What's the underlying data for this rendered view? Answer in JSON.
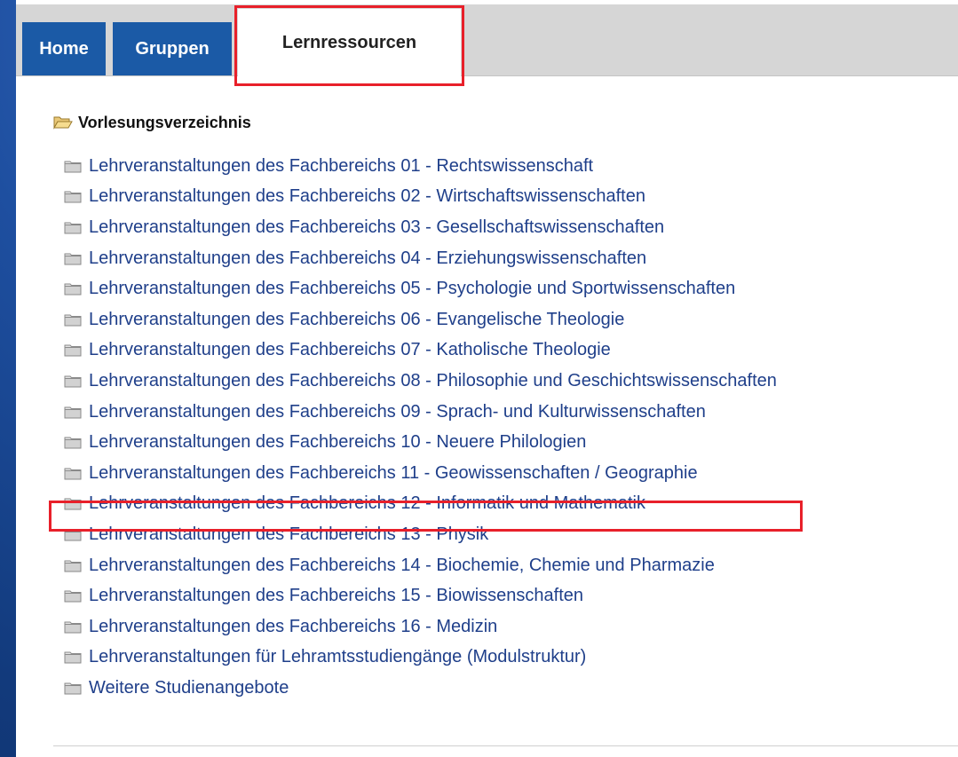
{
  "tabs": {
    "home": "Home",
    "groups": "Gruppen",
    "active": "Lernressourcen"
  },
  "tree": {
    "root_label": "Vorlesungsverzeichnis",
    "items": [
      "Lehrveranstaltungen des Fachbereichs 01 - Rechtswissenschaft",
      "Lehrveranstaltungen des Fachbereichs 02 - Wirtschaftswissenschaften",
      "Lehrveranstaltungen des Fachbereichs 03 - Gesellschaftswissenschaften",
      "Lehrveranstaltungen des Fachbereichs 04 - Erziehungswissenschaften",
      "Lehrveranstaltungen des Fachbereichs 05 - Psychologie und Sportwissenschaften",
      "Lehrveranstaltungen des Fachbereichs 06 - Evangelische Theologie",
      "Lehrveranstaltungen des Fachbereichs 07 - Katholische Theologie",
      "Lehrveranstaltungen des Fachbereichs 08 - Philosophie und Geschichtswissenschaften",
      "Lehrveranstaltungen des Fachbereichs 09 - Sprach- und Kulturwissenschaften",
      "Lehrveranstaltungen des Fachbereichs 10 - Neuere Philologien",
      "Lehrveranstaltungen des Fachbereichs 11 - Geowissenschaften / Geographie",
      "Lehrveranstaltungen des Fachbereichs 12 - Informatik und Mathematik",
      "Lehrveranstaltungen des Fachbereichs 13 - Physik",
      "Lehrveranstaltungen des Fachbereichs 14 - Biochemie, Chemie und Pharmazie",
      "Lehrveranstaltungen des Fachbereichs 15 - Biowissenschaften",
      "Lehrveranstaltungen des Fachbereichs 16 - Medizin",
      "Lehrveranstaltungen für Lehramtsstudiengänge (Modulstruktur)",
      "Weitere Studienangebote"
    ]
  },
  "colors": {
    "tab_blue": "#1b5aa6",
    "link_blue": "#1f3f8a",
    "highlight_red": "#e8202a"
  },
  "icons": {
    "root": "folder-open-icon",
    "item": "folder-icon"
  }
}
